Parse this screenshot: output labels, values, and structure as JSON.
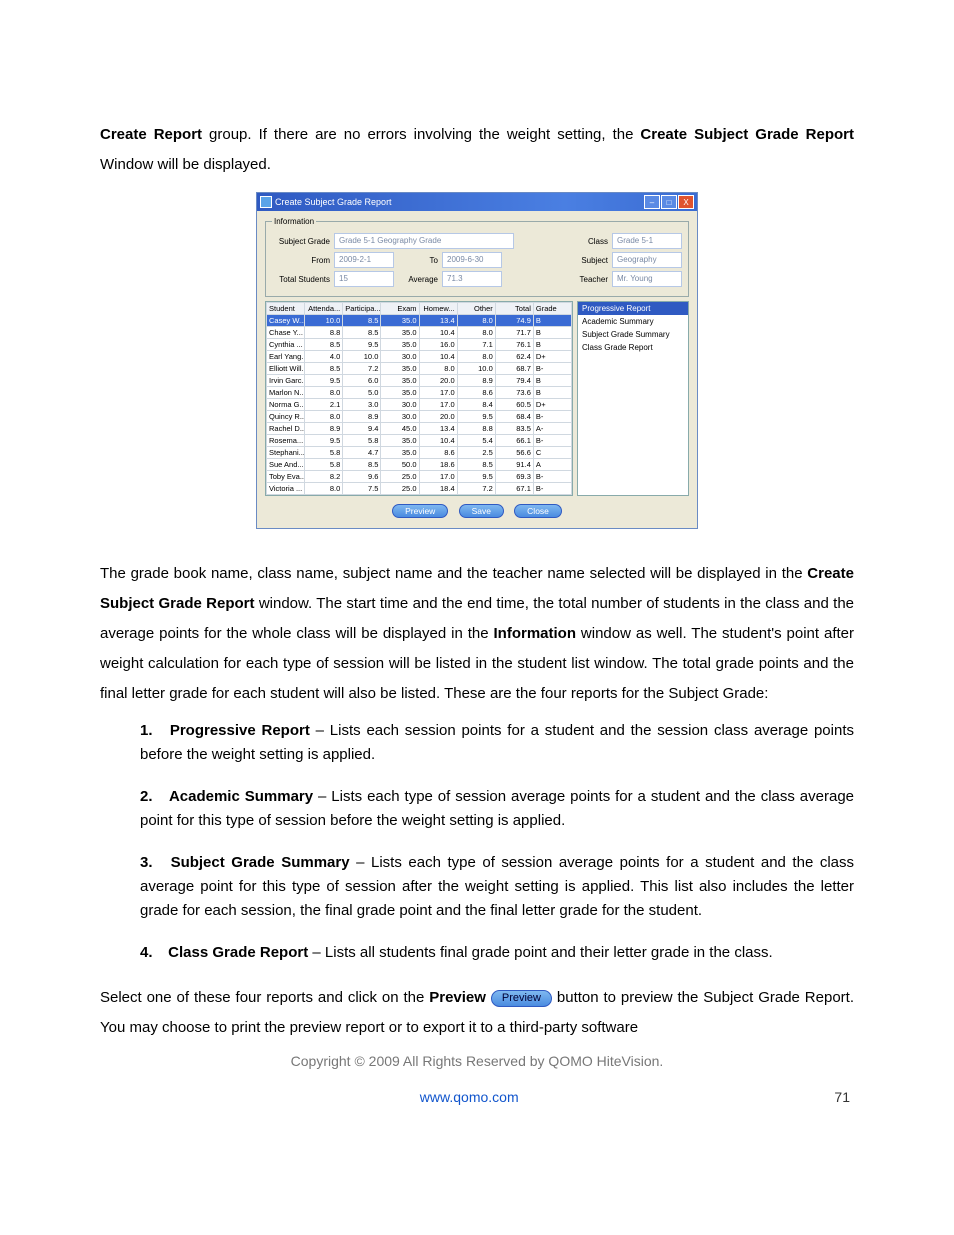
{
  "intro": {
    "part1a": "Create Report",
    "part1b": " group. If there are no errors involving the weight setting, the ",
    "part1c": "Create Subject Grade Report",
    "part1d": " Window will be displayed."
  },
  "window": {
    "title": "Create Subject Grade Report",
    "minimize_icon": "–",
    "maximize_icon": "□",
    "close_icon": "X",
    "info_legend": "Information",
    "labels": {
      "subject_grade": "Subject Grade",
      "from": "From",
      "to": "To",
      "total_students": "Total Students",
      "average": "Average",
      "class": "Class",
      "subject": "Subject",
      "teacher": "Teacher"
    },
    "values": {
      "subject_grade": "Grade 5-1 Geography Grade",
      "from": "2009-2-1",
      "to": "2009-6-30",
      "total_students": "15",
      "average": "71.3",
      "class": "Grade 5-1",
      "subject": "Geography",
      "teacher": "Mr. Young"
    },
    "columns": [
      "Student",
      "Attenda...",
      "Participa...",
      "Exam",
      "Homew...",
      "Other",
      "Total",
      "Grade"
    ],
    "rows": [
      {
        "sel": true,
        "c": [
          "Casey W...",
          "10.0",
          "8.5",
          "35.0",
          "13.4",
          "8.0",
          "74.9",
          "B"
        ]
      },
      {
        "sel": false,
        "c": [
          "Chase Y...",
          "8.8",
          "8.5",
          "35.0",
          "10.4",
          "8.0",
          "71.7",
          "B"
        ]
      },
      {
        "sel": false,
        "c": [
          "Cynthia ...",
          "8.5",
          "9.5",
          "35.0",
          "16.0",
          "7.1",
          "76.1",
          "B"
        ]
      },
      {
        "sel": false,
        "c": [
          "Earl Yang...",
          "4.0",
          "10.0",
          "30.0",
          "10.4",
          "8.0",
          "62.4",
          "D+"
        ]
      },
      {
        "sel": false,
        "c": [
          "Elliott Will...",
          "8.5",
          "7.2",
          "35.0",
          "8.0",
          "10.0",
          "68.7",
          "B-"
        ]
      },
      {
        "sel": false,
        "c": [
          "Irvin Garc...",
          "9.5",
          "6.0",
          "35.0",
          "20.0",
          "8.9",
          "79.4",
          "B"
        ]
      },
      {
        "sel": false,
        "c": [
          "Marlon N...",
          "8.0",
          "5.0",
          "35.0",
          "17.0",
          "8.6",
          "73.6",
          "B"
        ]
      },
      {
        "sel": false,
        "c": [
          "Norma G...",
          "2.1",
          "3.0",
          "30.0",
          "17.0",
          "8.4",
          "60.5",
          "D+"
        ]
      },
      {
        "sel": false,
        "c": [
          "Quincy R...",
          "8.0",
          "8.9",
          "30.0",
          "20.0",
          "9.5",
          "68.4",
          "B-"
        ]
      },
      {
        "sel": false,
        "c": [
          "Rachel D...",
          "8.9",
          "9.4",
          "45.0",
          "13.4",
          "8.8",
          "83.5",
          "A-"
        ]
      },
      {
        "sel": false,
        "c": [
          "Rosema...",
          "9.5",
          "5.8",
          "35.0",
          "10.4",
          "5.4",
          "66.1",
          "B-"
        ]
      },
      {
        "sel": false,
        "c": [
          "Stephani...",
          "5.8",
          "4.7",
          "35.0",
          "8.6",
          "2.5",
          "56.6",
          "C"
        ]
      },
      {
        "sel": false,
        "c": [
          "Sue And...",
          "5.8",
          "8.5",
          "50.0",
          "18.6",
          "8.5",
          "91.4",
          "A"
        ]
      },
      {
        "sel": false,
        "c": [
          "Toby Eva...",
          "8.2",
          "9.6",
          "25.0",
          "17.0",
          "9.5",
          "69.3",
          "B-"
        ]
      },
      {
        "sel": false,
        "c": [
          "Victoria ...",
          "8.0",
          "7.5",
          "25.0",
          "18.4",
          "7.2",
          "67.1",
          "B-"
        ]
      }
    ],
    "sidepanel": [
      {
        "label": "Progressive Report",
        "sel": true
      },
      {
        "label": "Academic Summary",
        "sel": false
      },
      {
        "label": "Subject Grade Summary",
        "sel": false
      },
      {
        "label": "Class Grade Report",
        "sel": false
      }
    ],
    "buttons": {
      "preview": "Preview",
      "save": "Save",
      "close": "Close"
    }
  },
  "para2": {
    "t1": "The grade book name, class name, subject name and the teacher name selected will be displayed in the ",
    "b1": "Create Subject Grade Report",
    "t2": " window. The start time and the end time, the total number of students in the class and the average points for the whole class will be displayed in the ",
    "b2": "Information",
    "t3": " window as well. The student's point after weight calculation for each type of session will be listed in the student list window. The total grade points and the final letter grade for each student will also be listed. These are the four reports for the Subject Grade:"
  },
  "reports": [
    {
      "num": "1.",
      "name": "Progressive Report",
      "desc": " – Lists each session points for a student and the session class average points before the weight setting is applied."
    },
    {
      "num": "2.",
      "name": "Academic Summary",
      "desc": " – Lists each type of session average points for a student and the class average point for this type of session before the weight setting is applied."
    },
    {
      "num": "3.",
      "name": "Subject Grade Summary",
      "desc": " – Lists each type of session average points for a student and the class average point for this type of session after the weight setting is applied. This list also includes the letter grade for each session, the final grade point and the final letter grade for the student."
    },
    {
      "num": "4.",
      "name": "Class Grade Report",
      "desc": " – Lists all students final grade point and their letter grade in the class."
    }
  ],
  "para3": {
    "t1": "Select one of these four reports and click on the ",
    "b1": "Preview",
    "chip": "Preview",
    "t2": " button to preview the Subject Grade Report. You may choose to print the preview report or to export it to a third-party software"
  },
  "copyright": "Copyright © 2009 All Rights Reserved by QOMO HiteVision.",
  "footer": {
    "url": "www.qomo.com",
    "page": "71"
  }
}
